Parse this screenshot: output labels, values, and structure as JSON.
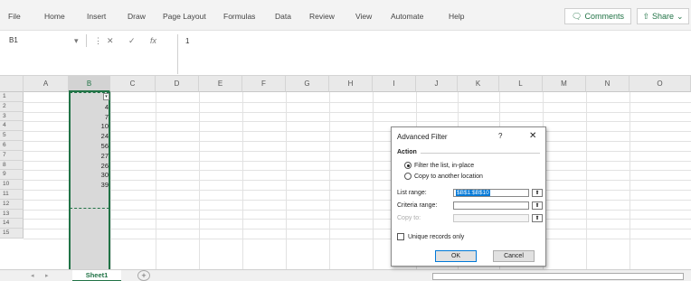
{
  "ribbon": {
    "menus": [
      "File",
      "Home",
      "Insert",
      "Draw",
      "Page Layout",
      "Formulas",
      "Data",
      "Review",
      "View",
      "Automate",
      "Help"
    ],
    "comments_label": "Comments",
    "share_label": "Share"
  },
  "formula_bar": {
    "name_box": "B1",
    "formula": "1"
  },
  "grid": {
    "columns": [
      "A",
      "B",
      "C",
      "D",
      "E",
      "F",
      "G",
      "H",
      "I",
      "J",
      "K",
      "L",
      "M",
      "N",
      "O"
    ],
    "rows": [
      "1",
      "2",
      "3",
      "4",
      "5",
      "6",
      "7",
      "8",
      "9",
      "10",
      "11",
      "12",
      "13",
      "14",
      "15"
    ],
    "column_b_values": [
      "",
      "4",
      "7",
      "10",
      "24",
      "56",
      "27",
      "26",
      "30",
      "39"
    ]
  },
  "sheet_tabs": {
    "active": "Sheet1",
    "add_label": "+"
  },
  "dialog": {
    "title": "Advanced Filter",
    "help": "?",
    "close": "✕",
    "action_label": "Action",
    "option_filter": "Filter the list, in-place",
    "option_copy": "Copy to another location",
    "selected_option": "filter",
    "list_range_label": "List range:",
    "list_range_value": "$B$1:$B$10",
    "criteria_range_label": "Criteria range:",
    "criteria_range_value": "",
    "copy_to_label": "Copy to:",
    "copy_to_value": "",
    "unique_label": "Unique records only",
    "unique_checked": false,
    "ok_label": "OK",
    "cancel_label": "Cancel"
  }
}
